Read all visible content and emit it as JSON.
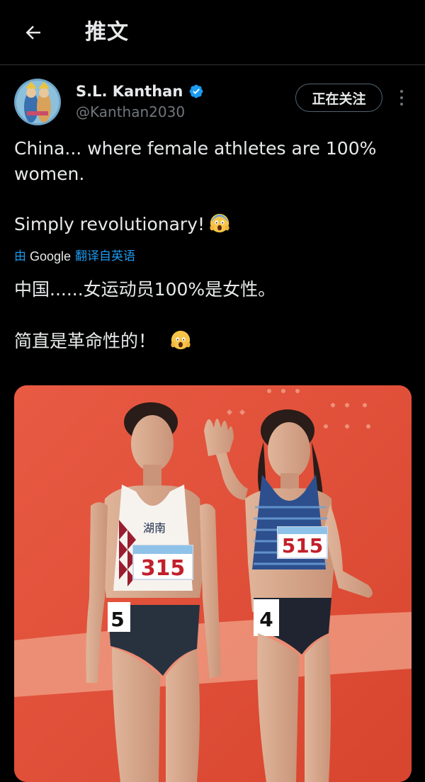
{
  "header": {
    "title": "推文"
  },
  "author": {
    "name": "S.L. Kanthan",
    "handle": "@Kanthan2030",
    "follow_label": "正在关注"
  },
  "tweet": {
    "line1": "China... where female athletes are 100%",
    "line2": "women.",
    "line3": "Simply revolutionary!",
    "translation_by": "由",
    "translation_provider": "Google",
    "translation_link": "翻译自英语",
    "translated_line1": "中国......女运动员100%是女性。",
    "translated_line2": "简直是革命性的！"
  },
  "media": {
    "bib_left": "315",
    "bib_right": "515",
    "team_text": "湖南",
    "hip_left": "5",
    "hip_right": "4"
  },
  "icons": {
    "back": "arrow-left-icon",
    "verified": "verified-badge-icon",
    "more": "more-vertical-icon",
    "emoji": "face-screaming-in-fear-emoji"
  },
  "colors": {
    "background": "#000000",
    "text": "#e7e9ea",
    "secondary": "#71767b",
    "accent": "#1d9bf0",
    "photo_bg": "#e2513b"
  }
}
